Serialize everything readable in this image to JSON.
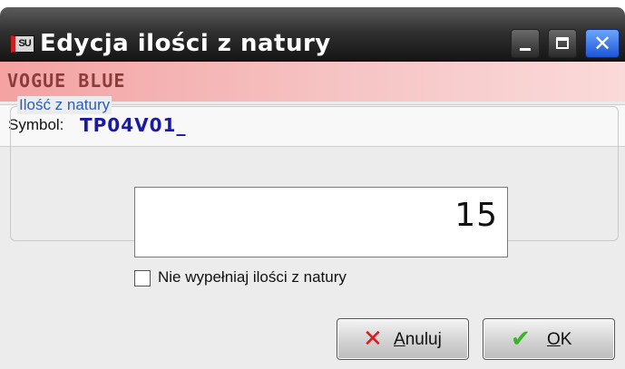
{
  "window": {
    "title": "Edycja ilości z natury",
    "app_icon": "SU",
    "controls": {
      "minimize_icon": "minimize-icon",
      "maximize_icon": "maximize-icon",
      "close_icon": "close-icon",
      "close_glyph": "✕"
    }
  },
  "header": {
    "name": "VOGUE BLUE"
  },
  "symbol": {
    "label": "Symbol:",
    "value": "TP04V01_"
  },
  "quantity_group": {
    "legend": "Ilość z natury",
    "value": "15"
  },
  "checkbox": {
    "label": "Nie wypełniaj ilości z natury",
    "checked": false
  },
  "buttons": {
    "cancel": {
      "label_first": "A",
      "label_rest": "nuluj",
      "icon": "x-icon",
      "glyph": "✕"
    },
    "ok": {
      "label_first": "O",
      "label_rest": "K",
      "icon": "checkmark-icon",
      "glyph": "✔"
    }
  },
  "colors": {
    "header_text": "#8c3b3b",
    "symbol_value": "#1a1aa0",
    "legend": "#2a5fb4",
    "close_button": "#1d54d8"
  }
}
